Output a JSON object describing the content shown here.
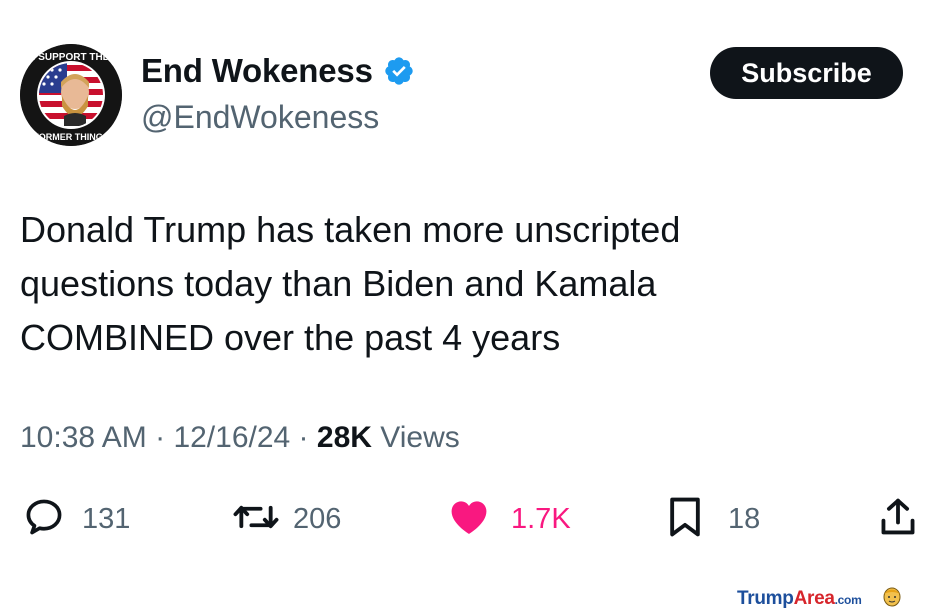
{
  "author": {
    "display_name": "End Wokeness",
    "handle": "@EndWokeness",
    "avatar_text_top": "I SUPPORT THE",
    "avatar_text_bottom": "FORMER THINGS",
    "verified_color": "#1d9bf0"
  },
  "subscribe_label": "Subscribe",
  "tweet": {
    "text": "Donald Trump has taken more unscripted\nquestions today than Biden and Kamala\nCOMBINED over the past 4 years"
  },
  "meta": {
    "time": "10:38 AM",
    "sep1": " · ",
    "date": "12/16/24",
    "sep2": " · ",
    "views_count": "28K",
    "views_label": " Views"
  },
  "actions": {
    "replies": "131",
    "retweets": "206",
    "likes": "1.7K",
    "bookmarks": "18"
  },
  "icons": {
    "reply": "speech-bubble-icon",
    "retweet": "retweet-arrows-icon",
    "like": "heart-filled-icon",
    "bookmark": "bookmark-icon",
    "share": "share-upload-icon"
  },
  "colors": {
    "like_active": "#f91880",
    "muted_text": "#536471",
    "watermark_blue": "#1d4f9c",
    "watermark_red": "#d7262c"
  },
  "watermark": {
    "part1": "Trump",
    "part2": "Area",
    "part3": ".com"
  }
}
